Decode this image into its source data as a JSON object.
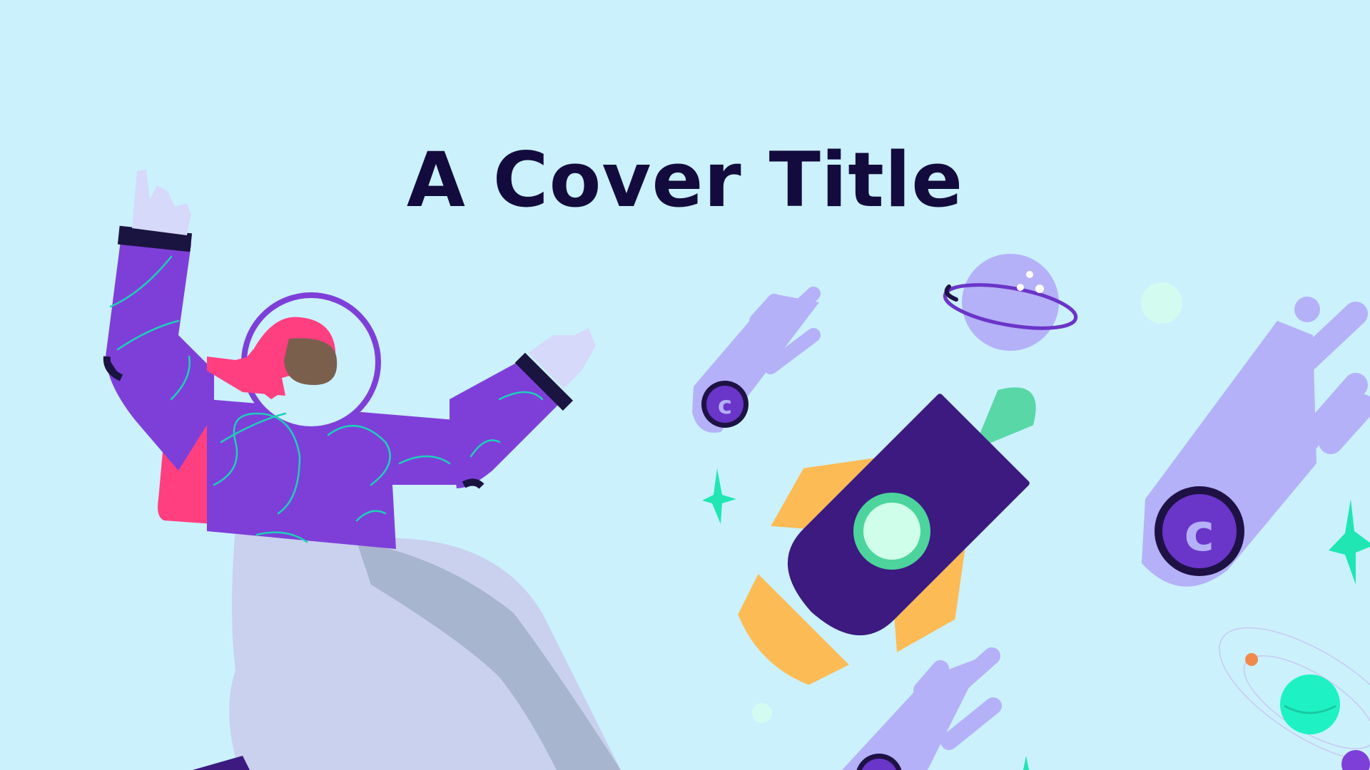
{
  "slide": {
    "title": "A Cover Title"
  },
  "palette": {
    "background": "#CBF1FD",
    "title": "#130B3D",
    "suit": "#7E3FD9",
    "suit_lines": "#1BD1B8",
    "hair": "#FF3F7F",
    "skin": "#7A5F4D",
    "pants": "#C9D1EE",
    "pants_shadow": "#A8B5CE",
    "glove": "#D6D9FA",
    "cuff": "#1A1440",
    "comet": "#B4B1F8",
    "coin": "#6A35C9",
    "coin_ring": "#1E1245",
    "rocket": "#3C1A80",
    "rocket_fin": "#FCBB55",
    "rocket_flame": "#59D7A7",
    "window": "#CFFFEA",
    "window_ring": "#4CD49C",
    "planet": "#A59FF2",
    "planet_ring": "#6B35C8",
    "sparkle": "#20E6B4",
    "teal_planet": "#1EF2C4",
    "orange_dot": "#F08A4A"
  },
  "icons": {
    "astronaut": "astronaut-illustration",
    "rocket": "rocket-illustration",
    "planet": "ringed-planet-illustration",
    "comet": "coin-comet-illustration",
    "sparkle": "four-point-star",
    "orbit": "orbit-system-illustration"
  }
}
